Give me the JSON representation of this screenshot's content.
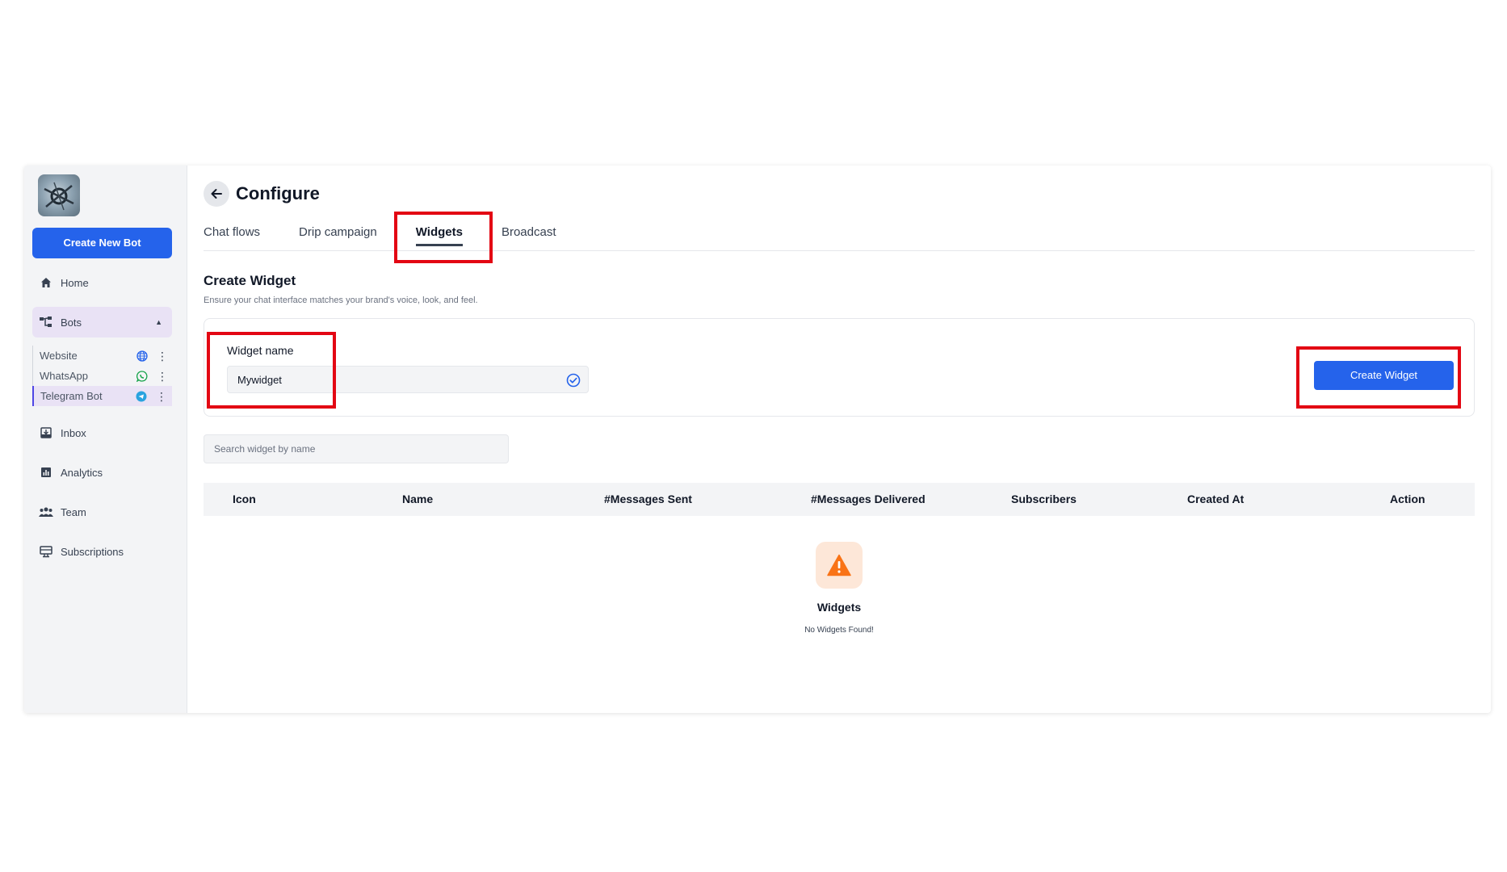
{
  "sidebar": {
    "create_bot_label": "Create New Bot",
    "nav": {
      "home": "Home",
      "bots": "Bots",
      "inbox": "Inbox",
      "analytics": "Analytics",
      "team": "Team",
      "subscriptions": "Subscriptions"
    },
    "bots": [
      {
        "label": "Website",
        "icon": "globe-icon"
      },
      {
        "label": "WhatsApp",
        "icon": "whatsapp-icon"
      },
      {
        "label": "Telegram Bot",
        "icon": "telegram-icon",
        "active": true
      }
    ]
  },
  "header": {
    "title": "Configure"
  },
  "tabs": [
    {
      "label": "Chat flows"
    },
    {
      "label": "Drip campaign"
    },
    {
      "label": "Widgets",
      "active": true
    },
    {
      "label": "Broadcast"
    }
  ],
  "create_widget": {
    "title": "Create Widget",
    "subtitle": "Ensure your chat interface matches your brand's voice, look, and feel.",
    "field_label": "Widget name",
    "field_value": "Mywidget",
    "button_label": "Create Widget"
  },
  "search": {
    "placeholder": "Search widget by name"
  },
  "table": {
    "columns": [
      "Icon",
      "Name",
      "#Messages Sent",
      "#Messages Delivered",
      "Subscribers",
      "Created At",
      "Action"
    ]
  },
  "empty_state": {
    "title": "Widgets",
    "message": "No Widgets Found!"
  },
  "colors": {
    "primary": "#2563eb",
    "highlight": "#e30613",
    "active_nav": "#e9e2f5",
    "warning": "#f97316"
  }
}
